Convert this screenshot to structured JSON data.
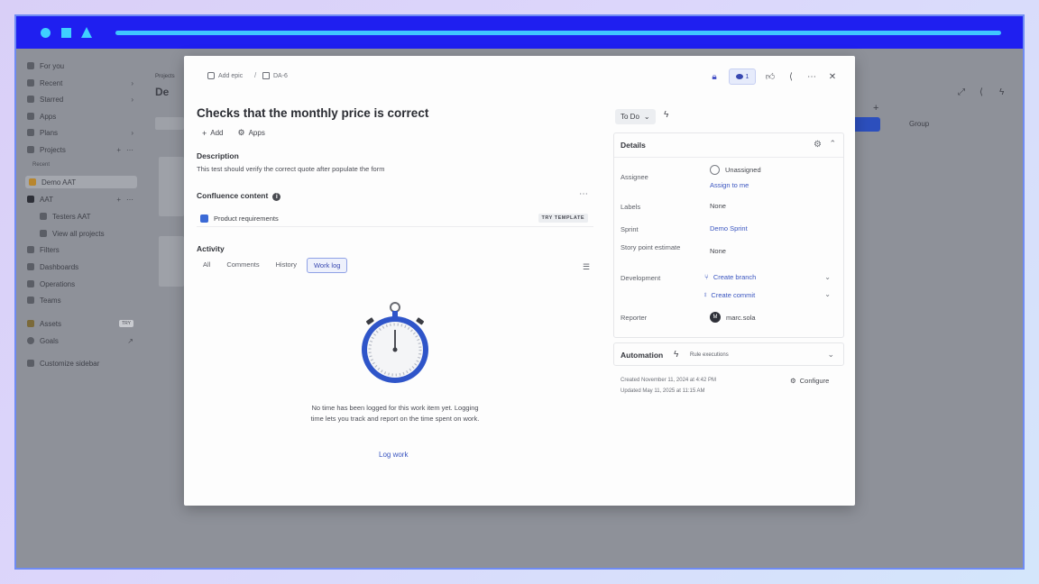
{
  "sidebar": {
    "items": [
      {
        "label": "For you"
      },
      {
        "label": "Recent"
      },
      {
        "label": "Starred"
      },
      {
        "label": "Apps"
      },
      {
        "label": "Plans"
      },
      {
        "label": "Projects"
      }
    ],
    "recent_label": "Recent",
    "projects": [
      {
        "label": "Demo AAT"
      },
      {
        "label": "AAT"
      },
      {
        "label": "Testers AAT"
      },
      {
        "label": "View all projects"
      }
    ],
    "more_items": [
      {
        "label": "Filters"
      },
      {
        "label": "Dashboards"
      },
      {
        "label": "Operations"
      },
      {
        "label": "Teams"
      }
    ],
    "assets": {
      "label": "Assets",
      "badge": "TRY"
    },
    "goals": {
      "label": "Goals"
    },
    "customize": {
      "label": "Customize sidebar"
    }
  },
  "background": {
    "projects_crumb": "Projects",
    "project_title": "De",
    "group_label": "Group"
  },
  "modal": {
    "breadcrumb": {
      "add_epic": "Add epic",
      "issue_key": "DA-6"
    },
    "watch_count": "1",
    "title": "Checks that the monthly price is correct",
    "actions": {
      "add": "Add",
      "apps": "Apps"
    },
    "description": {
      "heading": "Description",
      "text": "This test should verify the correct quote after populate the form"
    },
    "confluence": {
      "heading": "Confluence content",
      "page": "Product requirements",
      "try_template": "TRY TEMPLATE"
    },
    "activity": {
      "heading": "Activity",
      "tabs": [
        "All",
        "Comments",
        "History",
        "Work log"
      ],
      "active_tab": "Work log",
      "empty_message": "No time has been logged for this work item yet. Logging time lets you track and report on the time spent on work.",
      "log_work": "Log work"
    },
    "status": "To Do",
    "details": {
      "heading": "Details",
      "assignee": {
        "label": "Assignee",
        "value": "Unassigned",
        "assign_me": "Assign to me"
      },
      "labels": {
        "label": "Labels",
        "value": "None"
      },
      "sprint": {
        "label": "Sprint",
        "value": "Demo Sprint"
      },
      "story_points": {
        "label": "Story point estimate",
        "value": "None"
      },
      "development": {
        "label": "Development",
        "create_branch": "Create branch",
        "create_commit": "Create commit"
      },
      "reporter": {
        "label": "Reporter",
        "value": "marc.sola",
        "initial": "M"
      }
    },
    "automation": {
      "heading": "Automation",
      "rule": "Rule executions"
    },
    "meta": {
      "created": "Created November 11, 2024 at 4:42 PM",
      "updated": "Updated May 11, 2025 at 11:15 AM",
      "configure": "Configure"
    }
  }
}
